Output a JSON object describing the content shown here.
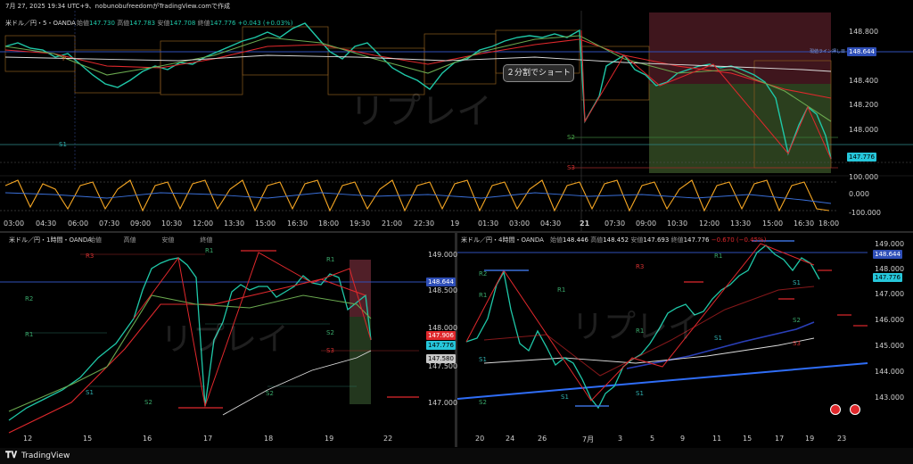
{
  "top_line": "7月 27, 2025 19:34 UTC+9、nobunobufreedomがTradingView.comで作成",
  "main": {
    "symbol": "米ドル／円・5・OANDA",
    "ohlc_labels": [
      "始値",
      "高値",
      "安値",
      "終値"
    ],
    "ohlc_values": [
      "147.730",
      "147.783",
      "147.708",
      "147.776"
    ],
    "change": "+0.043 (+0.03%)",
    "price_ticks": [
      "148.800",
      "148.600",
      "148.400",
      "148.200",
      "148.000",
      "147.800"
    ],
    "current_price": "147.776",
    "line_price": "148.644",
    "line_note": "現値ライン押し目",
    "annotation": "２分割でショート",
    "pivots": {
      "s1": "S1",
      "s2": "S2",
      "s3": "S3",
      "p": "P"
    },
    "watermark": "リプレイ",
    "time_ticks": [
      "03:00",
      "04:30",
      "06:00",
      "07:30",
      "09:00",
      "10:30",
      "12:00",
      "13:30",
      "15:00",
      "16:30",
      "18:00",
      "19:30",
      "21:00",
      "22:30",
      "19",
      "01:30",
      "03:00",
      "04:30",
      "21",
      "07:30",
      "09:00",
      "10:30",
      "12:00",
      "13:30",
      "15:00",
      "16:30",
      "18:00"
    ],
    "osc_ticks": [
      "100.000",
      "0.000",
      "-100.000"
    ]
  },
  "h1": {
    "symbol": "米ドル／円・1時間・OANDA",
    "ohlc_labels": [
      "始値",
      "高値",
      "安値",
      "終値"
    ],
    "price_ticks": [
      "149.000",
      "148.500",
      "148.000",
      "147.500",
      "147.000"
    ],
    "tags": {
      "line": "148.644",
      "red": "147.906",
      "cyan": "147.776",
      "gray": "147.580"
    },
    "pivots": [
      "R3",
      "R2",
      "R1",
      "S1",
      "S2",
      "S3",
      "P",
      "R2",
      "R1",
      "S1",
      "S2",
      "R3",
      "R1",
      "S2",
      "S3"
    ],
    "date_ticks": [
      "12",
      "15",
      "16",
      "17",
      "18",
      "19",
      "22"
    ],
    "watermark": "リプレイ"
  },
  "h4": {
    "symbol": "米ドル／円・4時間・OANDA",
    "ohlc_labels": [
      "始値",
      "高値",
      "安値",
      "終値"
    ],
    "ohlc_values": [
      "148.446",
      "148.452",
      "147.693",
      "147.776"
    ],
    "change": "−0.670 (−0.45%)",
    "price_ticks": [
      "149.000",
      "148.000",
      "147.000",
      "146.000",
      "145.000",
      "144.000",
      "143.000"
    ],
    "tags": {
      "line": "148.644",
      "cyan": "147.776"
    },
    "pivots": [
      "R2",
      "R1",
      "P",
      "S1",
      "S2",
      "R3",
      "R1",
      "P",
      "S1",
      "S2",
      "R1",
      "S1",
      "S2",
      "S3",
      "S1",
      "R1",
      "S1",
      "R3"
    ],
    "date_ticks": [
      "20",
      "24",
      "26",
      "7月",
      "3",
      "5",
      "9",
      "11",
      "15",
      "17",
      "19",
      "23"
    ],
    "watermark": "リプレイ"
  },
  "footer": {
    "brand": "TradingView"
  },
  "colors": {
    "up": "#1fc8a8",
    "down": "#e6e6e6",
    "ma_red": "#e0282c",
    "ma_green": "#6aa84f",
    "ma_white": "#dcdcdc",
    "osc_orange": "#f5a623",
    "osc_blue": "#3a6fd8",
    "accent_blue": "#2f6df6",
    "cyan_tag": "#26c6da"
  }
}
